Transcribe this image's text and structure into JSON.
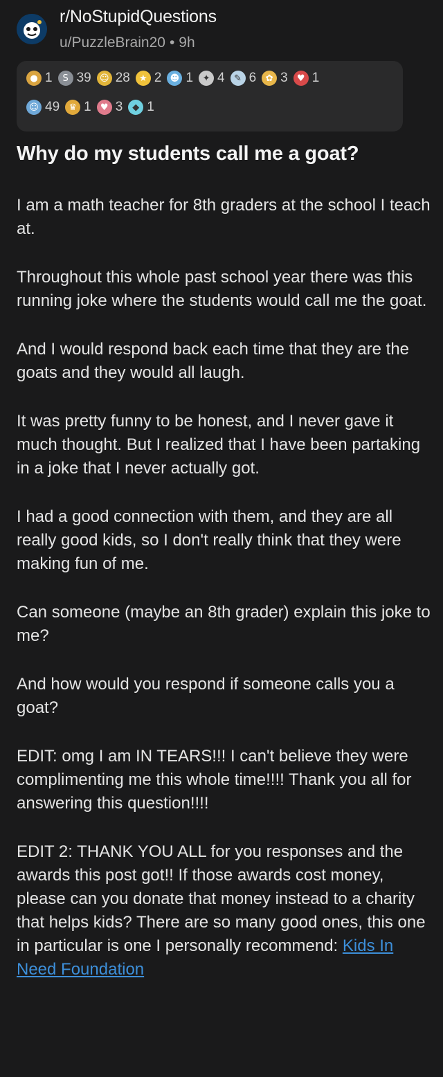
{
  "header": {
    "subreddit": "r/NoStupidQuestions",
    "user": "u/PuzzleBrain20",
    "separator": "•",
    "age": "9h"
  },
  "awards": {
    "row1": [
      {
        "icon": "helpful-award-icon",
        "color": "#d9a441",
        "count": "1"
      },
      {
        "icon": "silver-award-icon",
        "color": "#8a8f96",
        "count": "39"
      },
      {
        "icon": "wholesome-award-icon",
        "color": "#e2b53a",
        "count": "28"
      },
      {
        "icon": "gold-award-icon",
        "color": "#f0c23b",
        "count": "2"
      },
      {
        "icon": "laughing-award-icon",
        "color": "#6ab0e0",
        "count": "1"
      },
      {
        "icon": "rocket-award-icon",
        "color": "#c9c9c9",
        "count": "4"
      },
      {
        "icon": "pencil-award-icon",
        "color": "#b9d3e6",
        "count": "6"
      },
      {
        "icon": "hug-award-icon",
        "color": "#e8b64a",
        "count": "3"
      },
      {
        "icon": "heart-award-icon",
        "color": "#d84a4a",
        "count": "1"
      }
    ],
    "row2": [
      {
        "icon": "face-award-icon",
        "color": "#6fa8d8",
        "count": "49"
      },
      {
        "icon": "trophy-award-icon",
        "color": "#e1a93b",
        "count": "1"
      },
      {
        "icon": "heart-eyes-award-icon",
        "color": "#e07b8c",
        "count": "3"
      },
      {
        "icon": "platinum-award-icon",
        "color": "#6fd0e0",
        "count": "1"
      }
    ]
  },
  "post": {
    "title": "Why do my students call me a goat?",
    "paragraphs": [
      "I am a math teacher for 8th graders at the school I teach at.",
      "Throughout this whole past school year there was this running joke where the students would call me the goat.",
      "And I would respond back each time that they are the goats and they would all laugh.",
      "It was pretty funny to be honest, and I never gave it much thought. But I realized that I have been partaking in a joke that I never actually got.",
      "I had a good connection with them, and they are all really good kids, so I don't really think that they were making fun of me.",
      "Can someone (maybe an 8th grader) explain this joke to me?",
      "And how would you respond if someone calls you a goat?",
      "EDIT: omg I am IN TEARS!!! I can't believe they were complimenting me this whole time!!!! Thank you all for answering this question!!!!"
    ],
    "edit2_text": "EDIT 2: THANK YOU ALL for you responses and the awards this post got!! If those awards cost money, please can you donate that money instead to a charity that helps kids? There are so many good ones, this one in particular is one I personally recommend: ",
    "edit2_link": "Kids In Need Foundation",
    "link_color": "#3d8fd9"
  }
}
